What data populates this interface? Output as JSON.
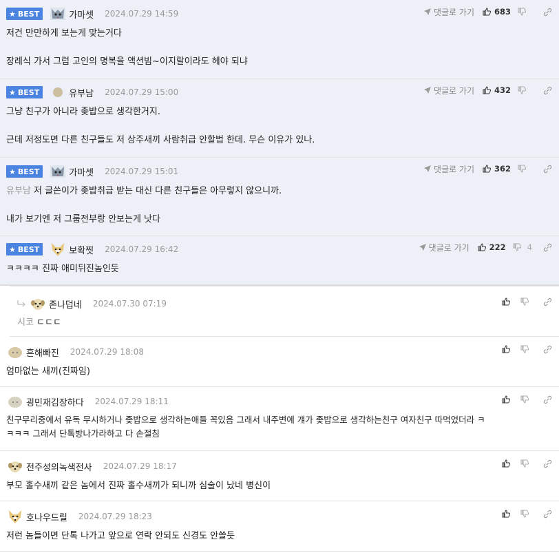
{
  "labels": {
    "best": "BEST",
    "reply_link": "댓글로 가기"
  },
  "colors": {
    "best_badge": "#4a83e0",
    "best_row_bg": "#eef0f8",
    "timestamp": "#999999"
  },
  "comments": [
    {
      "best": true,
      "avatar": "husky-icon",
      "nick": "가마셋",
      "time": "2024.07.29 14:59",
      "likes": "683",
      "dislikes": "",
      "lines": [
        "저건 만만하게 보는게 맞는거다",
        "장례식 가서 그럼 고인의 명복을 액션빔~이지랄이라도 헤야 되냐"
      ]
    },
    {
      "best": true,
      "avatar": "dot-icon",
      "nick": "유부남",
      "time": "2024.07.29 15:00",
      "likes": "432",
      "dislikes": "",
      "lines": [
        "그냥 친구가 아니라 좆밥으로 생각한거지.",
        "근데 저정도면 다른 친구들도 저 상주새끼 사람취급 안할법 한데. 무슨 이유가 있나."
      ]
    },
    {
      "best": true,
      "avatar": "husky-icon",
      "nick": "가마셋",
      "time": "2024.07.29 15:01",
      "likes": "362",
      "dislikes": "",
      "mention": "유부남",
      "lines": [
        "저 글쓴이가 좆밥취급 받는 대신 다른 친구들은 아무렇지 않으니까.",
        "내가 보기엔 저 그룹전부랑 안보는게 낫다"
      ]
    },
    {
      "best": true,
      "avatar": "fox-icon",
      "nick": "보확찟",
      "time": "2024.07.29 16:42",
      "likes": "222",
      "dislikes": "4",
      "lines": [
        "ㅋㅋㅋㅋ 진짜 애미뒤진놈인듯"
      ]
    },
    {
      "best": false,
      "reply": true,
      "avatar": "puppy-icon",
      "nick": "존나덥네",
      "time": "2024.07.30 07:19",
      "mention": "시코",
      "lines": [
        "ㄷㄷㄷ"
      ]
    },
    {
      "best": false,
      "avatar": "blob-icon",
      "nick": "흔해빠진",
      "time": "2024.07.29 18:08",
      "lines": [
        "엄마없는 새끼(진짜임)"
      ]
    },
    {
      "best": false,
      "avatar": "blob-icon",
      "nick": "굉민재김장하다",
      "time": "2024.07.29 18:11",
      "lines": [
        "친구무리중에서 유독 무시하거나 좆밥으로 생각하는애들 꼭있음 그래서 내주변에 걔가 좆밥으로 생각하는친구 여자친구 따먹었더라 ㅋ",
        "ㅋㅋㅋ 그래서 단톡방나가라하고 다 손절침"
      ]
    },
    {
      "best": false,
      "avatar": "puppy-icon",
      "nick": "전주성의녹색전사",
      "time": "2024.07.29 18:17",
      "lines": [
        "부모 홀수새끼 같은 놈에서 진짜 홀수새끼가 되니까 심술이 났네 병신이"
      ]
    },
    {
      "best": false,
      "avatar": "fox-icon",
      "nick": "호나우드릴",
      "time": "2024.07.29 18:23",
      "lines": [
        "저런 놈들이면 단톡 나가고 앞으로 연락 안되도 신경도 안쓸듯"
      ]
    }
  ]
}
